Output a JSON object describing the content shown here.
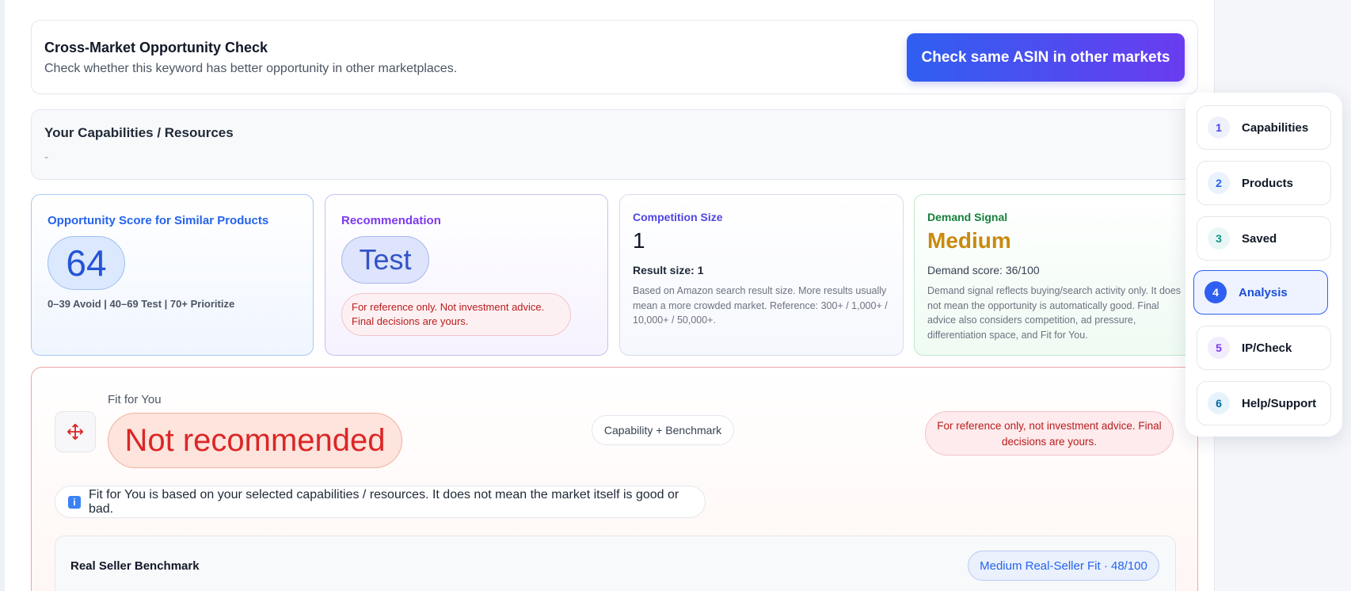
{
  "cross_market": {
    "title": "Cross-Market Opportunity Check",
    "subtitle": "Check whether this keyword has better opportunity in other marketplaces.",
    "button_label": "Check same ASIN in other markets"
  },
  "capabilities": {
    "title": "Your Capabilities / Resources",
    "value": "-"
  },
  "metrics": {
    "opportunity": {
      "label": "Opportunity Score for Similar Products",
      "score": "64",
      "scale": "0–39 Avoid | 40–69 Test | 70+ Prioritize"
    },
    "recommendation": {
      "label": "Recommendation",
      "value": "Test",
      "note": "For reference only. Not investment advice. Final decisions are yours."
    },
    "competition": {
      "label": "Competition Size",
      "value": "1",
      "result_size": "Result size: 1",
      "description": "Based on Amazon search result size. More results usually mean a more crowded market. Reference: 300+ / 1,000+ / 10,000+ / 50,000+."
    },
    "demand": {
      "label": "Demand Signal",
      "value": "Medium",
      "score": "Demand score: 36/100",
      "description": "Demand signal reflects buying/search activity only. It does not mean the opportunity is automatically good. Final advice also considers competition, ad pressure, differentiation space, and Fit for You."
    }
  },
  "fit": {
    "label": "Fit for You",
    "verdict": "Not recommended",
    "basis": "Capability + Benchmark",
    "reference": "For reference only, not investment advice. Final decisions are yours.",
    "info_icon": "info-icon",
    "info": "Fit for You is based on your selected capabilities / resources. It does not mean the market itself is good or bad.",
    "benchmark": {
      "title": "Real Seller Benchmark",
      "badge": "Medium Real-Seller Fit · 48/100"
    }
  },
  "nav": {
    "items": [
      {
        "num": "1",
        "label": "Capabilities",
        "color": "#4f46e5",
        "bg": "#eef0fb"
      },
      {
        "num": "2",
        "label": "Products",
        "color": "#2563eb",
        "bg": "#eaf2fd"
      },
      {
        "num": "3",
        "label": "Saved",
        "color": "#0d9488",
        "bg": "#e8f7f5"
      },
      {
        "num": "4",
        "label": "Analysis",
        "color": "#ffffff",
        "bg": "#2f5ff0"
      },
      {
        "num": "5",
        "label": "IP/Check",
        "color": "#7c3aed",
        "bg": "#f2ecfd"
      },
      {
        "num": "6",
        "label": "Help/Support",
        "color": "#0369a1",
        "bg": "#e6f3fb"
      }
    ],
    "active": "Analysis"
  },
  "colors": {
    "accent": "#2f5ff0",
    "danger": "#dc2626",
    "medium": "#c98a0e"
  }
}
